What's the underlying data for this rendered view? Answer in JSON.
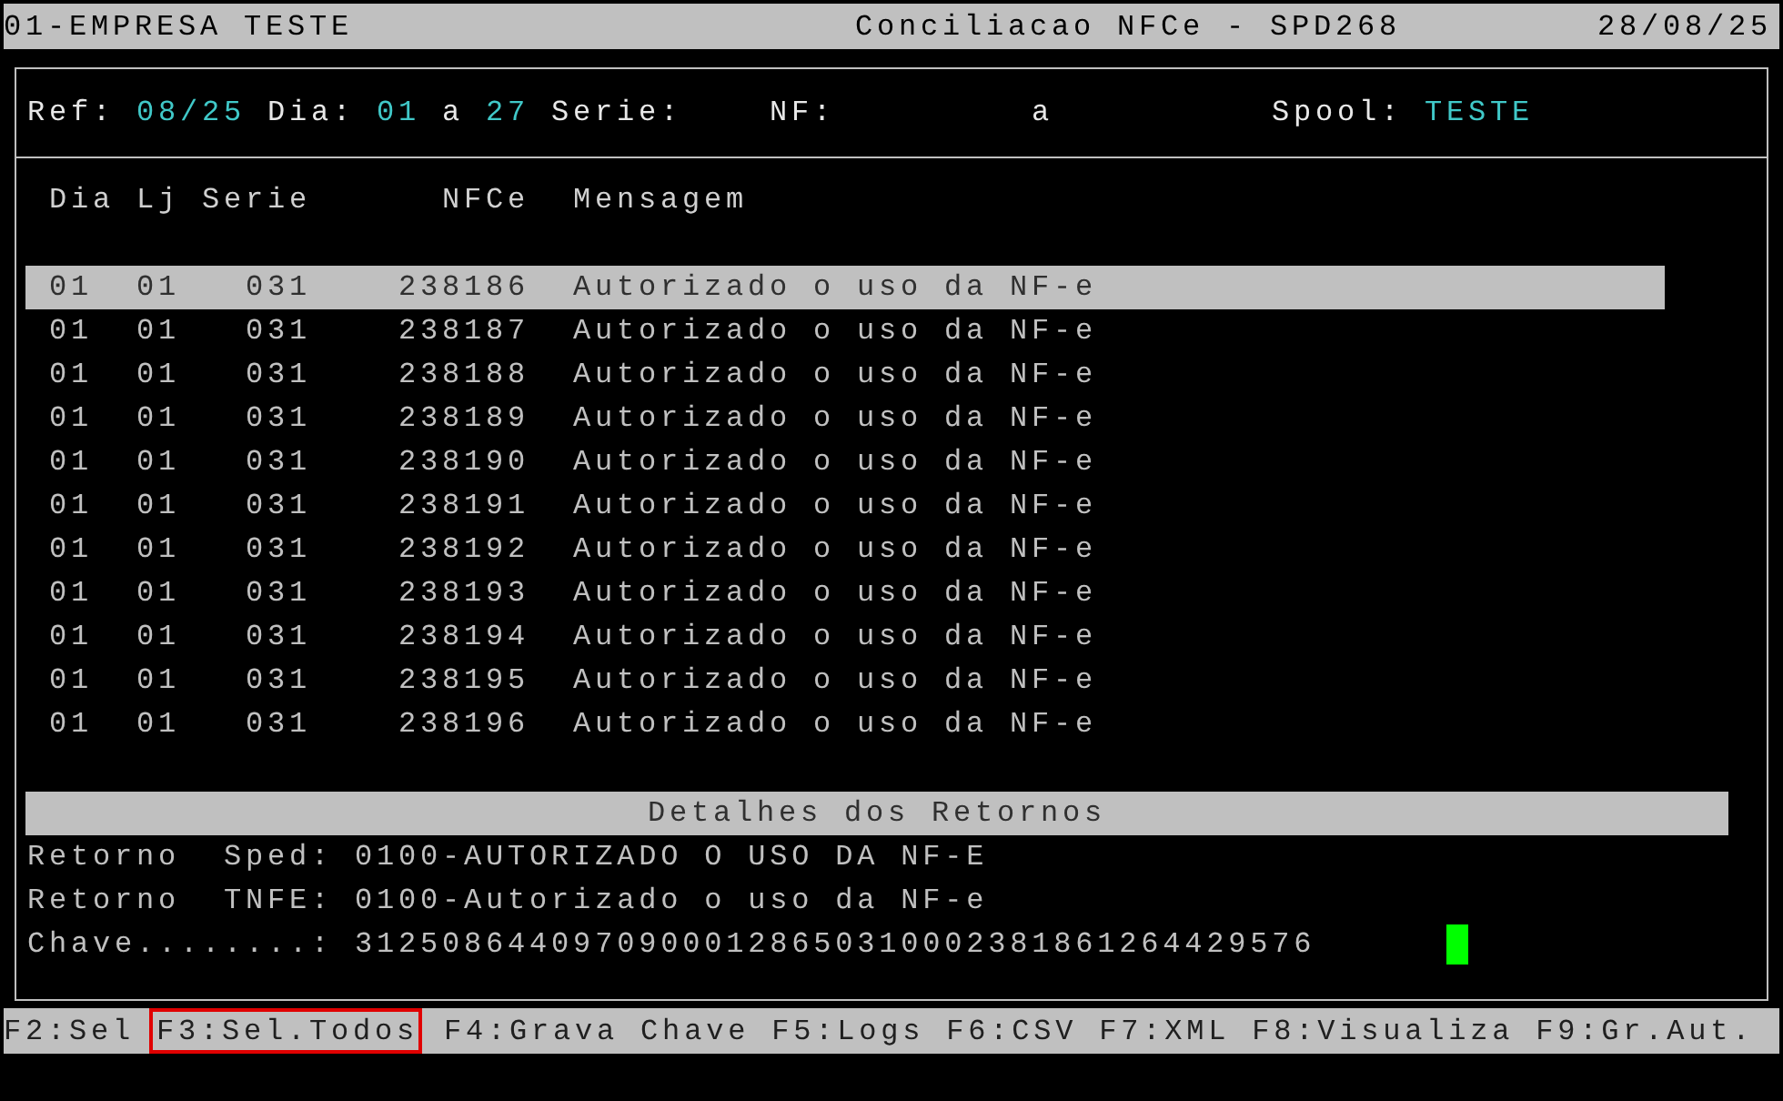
{
  "title_bar": {
    "company": "01-EMPRESA TESTE",
    "title": "Conciliacao NFCe - SPD268",
    "date": "28/08/25"
  },
  "filters": [
    {
      "kind": "label",
      "text": "Ref:"
    },
    {
      "kind": "value",
      "text": "08/25"
    },
    {
      "kind": "label",
      "text": "Dia:"
    },
    {
      "kind": "value",
      "text": "01"
    },
    {
      "kind": "label",
      "text": "a"
    },
    {
      "kind": "value",
      "text": "27"
    },
    {
      "kind": "label",
      "text": "Serie:"
    },
    {
      "kind": "label",
      "text": "NF:"
    },
    {
      "kind": "label",
      "text": "a"
    },
    {
      "kind": "label",
      "text": "Spool:"
    },
    {
      "kind": "value",
      "text": "TESTE"
    }
  ],
  "table": {
    "columns": [
      "Dia",
      "Lj",
      "Serie",
      "NFCe",
      "Mensagem"
    ],
    "rows": [
      {
        "selected": true,
        "cells": [
          "01",
          "01",
          "031",
          "238186",
          "Autorizado o uso da NF-e"
        ]
      },
      {
        "selected": false,
        "cells": [
          "01",
          "01",
          "031",
          "238187",
          "Autorizado o uso da NF-e"
        ]
      },
      {
        "selected": false,
        "cells": [
          "01",
          "01",
          "031",
          "238188",
          "Autorizado o uso da NF-e"
        ]
      },
      {
        "selected": false,
        "cells": [
          "01",
          "01",
          "031",
          "238189",
          "Autorizado o uso da NF-e"
        ]
      },
      {
        "selected": false,
        "cells": [
          "01",
          "01",
          "031",
          "238190",
          "Autorizado o uso da NF-e"
        ]
      },
      {
        "selected": false,
        "cells": [
          "01",
          "01",
          "031",
          "238191",
          "Autorizado o uso da NF-e"
        ]
      },
      {
        "selected": false,
        "cells": [
          "01",
          "01",
          "031",
          "238192",
          "Autorizado o uso da NF-e"
        ]
      },
      {
        "selected": false,
        "cells": [
          "01",
          "01",
          "031",
          "238193",
          "Autorizado o uso da NF-e"
        ]
      },
      {
        "selected": false,
        "cells": [
          "01",
          "01",
          "031",
          "238194",
          "Autorizado o uso da NF-e"
        ]
      },
      {
        "selected": false,
        "cells": [
          "01",
          "01",
          "031",
          "238195",
          "Autorizado o uso da NF-e"
        ]
      },
      {
        "selected": false,
        "cells": [
          "01",
          "01",
          "031",
          "238196",
          "Autorizado o uso da NF-e"
        ]
      }
    ]
  },
  "details": {
    "title": "Detalhes dos Retornos",
    "lines": [
      {
        "label": "Retorno  Sped:",
        "value": "0100-AUTORIZADO O USO DA NF-E"
      },
      {
        "label": "Retorno  TNFE:",
        "value": "0100-Autorizado o uso da NF-e"
      },
      {
        "label": "Chave........:",
        "value": "31250864409709000128650310002381861264429576"
      }
    ]
  },
  "function_keys": [
    {
      "label": "F2:Sel",
      "highlighted": false
    },
    {
      "label": "F3:Sel.Todos",
      "highlighted": true
    },
    {
      "label": "F4:Grava Chave",
      "highlighted": false
    },
    {
      "label": "F5:Logs",
      "highlighted": false
    },
    {
      "label": "F6:CSV",
      "highlighted": false
    },
    {
      "label": "F7:XML",
      "highlighted": false
    },
    {
      "label": "F8:Visualiza",
      "highlighted": false
    },
    {
      "label": "F9:Gr.Aut.",
      "highlighted": false
    }
  ]
}
